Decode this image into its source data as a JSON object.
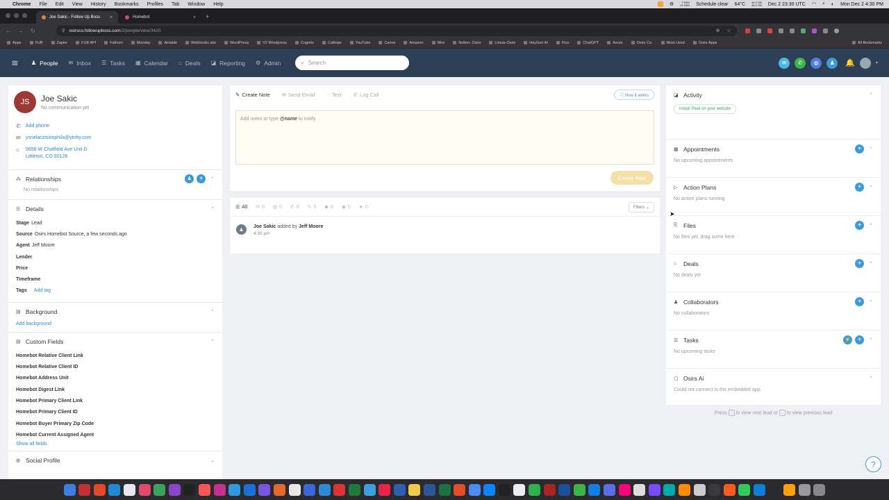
{
  "macos": {
    "app": "Chrome",
    "menu": [
      "File",
      "Edit",
      "View",
      "History",
      "Bookmarks",
      "Profiles",
      "Tab",
      "Window",
      "Help"
    ],
    "net_up": "7 KB/s",
    "net_down": "14 KB/s",
    "schedule": "Schedule clear",
    "temp": "64°C",
    "mem1": "44.0 GB",
    "mem2": "46.0 GB",
    "utc_time": "Dec 2  23:30 UTC",
    "clock": "Mon Dec 2  4:30 PM"
  },
  "browser": {
    "tabs": [
      {
        "title": "Joe Sakic - Follow Up Boss",
        "active": true,
        "color": "#e0834a"
      },
      {
        "title": "Homebot",
        "active": false,
        "color": "#d24a6a"
      }
    ],
    "url_host": "osirsco.followupboss.com",
    "url_path": "/2/people/view/3420",
    "bookmarks": [
      "Apps",
      "FUB",
      "Zapier",
      "FUB API",
      "Fathom",
      "Monday",
      "Airtable",
      "Webhooks.site",
      "WordPress",
      "V2 Wordpress",
      "Cognito",
      "Calliope",
      "YouTube",
      "Canva",
      "Amazon",
      "Miro",
      "Notion- Osirs",
      "Linear-Osirs",
      "HeyGen AI",
      "Flux",
      "ChatGPT",
      "Azure",
      "Osirs Co.",
      "Most Used",
      "Osirs Apps"
    ],
    "all_bookmarks": "All Bookmarks"
  },
  "nav": {
    "items": [
      {
        "label": "People",
        "icon": "♟",
        "active": true
      },
      {
        "label": "Inbox",
        "icon": "✉",
        "active": false
      },
      {
        "label": "Tasks",
        "icon": "☰",
        "active": false
      },
      {
        "label": "Calendar",
        "icon": "▦",
        "active": false
      },
      {
        "label": "Deals",
        "icon": "⌂",
        "active": false
      },
      {
        "label": "Reporting",
        "icon": "◪",
        "active": false
      },
      {
        "label": "Admin",
        "icon": "⚙",
        "active": false
      }
    ],
    "search_placeholder": "Search"
  },
  "person": {
    "initials": "JS",
    "name": "Joe Sakic",
    "comm_status": "No communication yet",
    "add_phone": "Add phone",
    "email": "ysnelaczisiosphila@ytnhy.com",
    "address_line1": "9658 W Chatfield Ave Unit D",
    "address_line2": "Littleton, CO 80128"
  },
  "relationships": {
    "title": "Relationships",
    "empty": "No relationships"
  },
  "details": {
    "title": "Details",
    "rows": [
      {
        "label": "Stage",
        "value": "Lead"
      },
      {
        "label": "Source",
        "value": "Osirs Homebot Source, a few seconds ago"
      },
      {
        "label": "Agent",
        "value": "Jeff Moore"
      },
      {
        "label": "Lender",
        "value": ""
      },
      {
        "label": "Price",
        "value": ""
      },
      {
        "label": "Timeframe",
        "value": ""
      }
    ],
    "tags_label": "Tags",
    "add_tag": "Add tag"
  },
  "background": {
    "title": "Background",
    "add": "Add background"
  },
  "custom_fields": {
    "title": "Custom Fields",
    "fields": [
      "Homebot Relative Client Link",
      "Homebot Relative Client ID",
      "Homebot Address Unit",
      "Homebot Digest Link",
      "Homebot Primary Client Link",
      "Homebot Primary Client ID",
      "Homebot Buyer Primary Zip Code",
      "Homebot Current Assigned Agent"
    ],
    "show_all": "Show all fields"
  },
  "social": {
    "title": "Social Profile"
  },
  "composer": {
    "tabs": [
      {
        "label": "Create Note",
        "icon": "✎",
        "active": true
      },
      {
        "label": "Send Email",
        "icon": "✉",
        "active": false
      },
      {
        "label": "Text",
        "icon": "◌",
        "active": false
      },
      {
        "label": "Log Call",
        "icon": "✆",
        "active": false
      }
    ],
    "how_it_works": "How it works",
    "placeholder_prefix": "Add notes or type ",
    "placeholder_bold": "@name",
    "placeholder_suffix": " to notify",
    "create_button": "Create Note"
  },
  "timeline": {
    "filters": [
      {
        "label": "All",
        "icon": "☰",
        "count": ""
      },
      {
        "label": "email",
        "icon": "✉",
        "count": "0"
      },
      {
        "label": "text",
        "icon": "◍",
        "count": "0"
      },
      {
        "label": "call",
        "icon": "✆",
        "count": "0"
      },
      {
        "label": "note",
        "icon": "✎",
        "count": "0"
      },
      {
        "label": "chat",
        "icon": "◆",
        "count": "0"
      },
      {
        "label": "drip",
        "icon": "◉",
        "count": "0"
      },
      {
        "label": "star",
        "icon": "★",
        "count": "0"
      }
    ],
    "filters_button": "Filters",
    "event_person": "Joe Sakic",
    "event_action": "added by",
    "event_actor": "Jeff Moore",
    "event_time": "4:30 pm"
  },
  "right": {
    "activity": {
      "title": "Activity",
      "pixel_button": "Install Pixel on your website"
    },
    "sections": [
      {
        "title": "Appointments",
        "icon": "▦",
        "empty": "No upcoming appointments",
        "action": "plus"
      },
      {
        "title": "Action Plans",
        "icon": "▷",
        "empty": "No action plans running",
        "action": "plus"
      },
      {
        "title": "Files",
        "icon": "⎘",
        "empty": "No files yet, drag some here",
        "action": "plus"
      },
      {
        "title": "Deals",
        "icon": "⌂",
        "empty": "No deals yet",
        "action": "plus"
      },
      {
        "title": "Collaborators",
        "icon": "♟",
        "empty": "No collaborators",
        "action": "plus"
      },
      {
        "title": "Tasks",
        "icon": "☰",
        "empty": "No upcoming tasks",
        "action": "lightning"
      }
    ],
    "osirs_ai": {
      "title": "Osirs Ai",
      "message": "Could not connect to the embedded app."
    },
    "press_prefix": "Press",
    "press_mid": "to view next lead or",
    "press_suffix": "to view previous lead"
  },
  "colors": {
    "nav_bg": "#2d3f54",
    "accent_blue": "#3d9ad6",
    "avatar_red": "#9c3838",
    "pixel_green": "#3aa35a"
  }
}
